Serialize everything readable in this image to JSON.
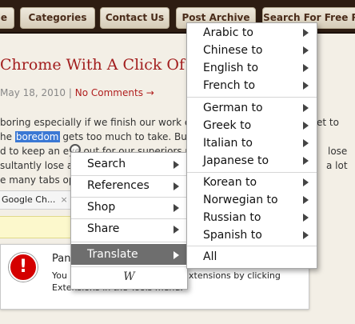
{
  "nav": {
    "items": [
      "e",
      "Categories",
      "Contact Us",
      "Post Archive",
      "Search For Free Re"
    ]
  },
  "post": {
    "title": "Chrome With A Click Of A Bu",
    "date": "May 18, 2010",
    "separator": "|",
    "comments": "No Comments →",
    "lines": [
      "boring especially if we finish our work early",
      "he",
      "boredom",
      " gets too much to take. But the",
      "d to keep an eye out for our superiors pass",
      "sultantly lose all",
      "e many tabs ope"
    ],
    "right_fragments": [
      "et to",
      "lose",
      "a lot"
    ]
  },
  "extension_bar": {
    "tab_label": "Google Ch...",
    "close": "×"
  },
  "notice": {
    "icon": "!",
    "title": "Pan",
    "line1": "You",
    "line1_right": "xtensions by clicking",
    "line2": "Extensions in the Tools menu."
  },
  "context_menu": {
    "items": [
      {
        "label": "Search",
        "submenu": true
      },
      {
        "label": "References",
        "submenu": true
      },
      {
        "label": "Shop",
        "submenu": true
      },
      {
        "label": "Share",
        "submenu": true
      },
      {
        "label": "Translate",
        "submenu": true,
        "selected": true
      }
    ],
    "footer_icon": "wikipedia-icon",
    "footer_glyph": "W"
  },
  "translate_menu": {
    "items": [
      {
        "label": "Arabic to",
        "submenu": true
      },
      {
        "label": "Chinese to",
        "submenu": true
      },
      {
        "label": "English to",
        "submenu": true
      },
      {
        "label": "French to",
        "submenu": true
      },
      {
        "label": "German to",
        "submenu": true
      },
      {
        "label": "Greek to",
        "submenu": true
      },
      {
        "label": "Italian to",
        "submenu": true
      },
      {
        "label": "Japanese to",
        "submenu": true
      },
      {
        "label": "Korean to",
        "submenu": true
      },
      {
        "label": "Norwegian to",
        "submenu": true
      },
      {
        "label": "Russian to",
        "submenu": true
      },
      {
        "label": "Spanish to",
        "submenu": true
      },
      {
        "label": "All",
        "submenu": false
      }
    ]
  },
  "colors": {
    "nav_bg": "#2e1d12",
    "title_red": "#a21d1d",
    "selection_blue": "#3b78d4",
    "menu_selected": "#6e6e6e"
  }
}
